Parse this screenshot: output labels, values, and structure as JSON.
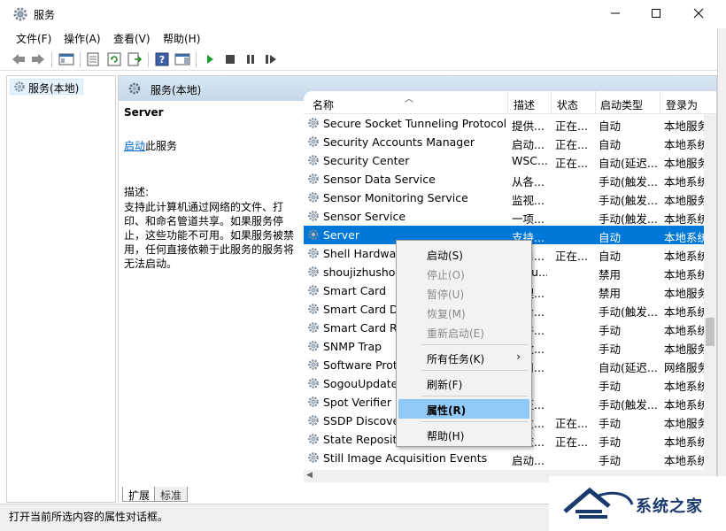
{
  "window": {
    "title": "服务"
  },
  "menu": [
    "文件(F)",
    "操作(A)",
    "查看(V)",
    "帮助(H)"
  ],
  "tree": {
    "root": "服务(本地)"
  },
  "panel": {
    "header": "服务(本地)",
    "selected_service": "Server",
    "start_link": "启动",
    "start_suffix": "此服务",
    "desc_label": "描述:",
    "desc_text": "支持此计算机通过网络的文件、打印、和命名管道共享。如果服务停止，这些功能不可用。如果服务被禁用，任何直接依赖于此服务的服务将无法启动。"
  },
  "columns": [
    "名称",
    "描述",
    "状态",
    "启动类型",
    "登录为"
  ],
  "rows": [
    {
      "name": "Secure Socket Tunneling Protocol...",
      "desc": "提供...",
      "state": "正在...",
      "start": "自动",
      "logon": "本地服务"
    },
    {
      "name": "Security Accounts Manager",
      "desc": "启动...",
      "state": "正在...",
      "start": "自动",
      "logon": "本地系统"
    },
    {
      "name": "Security Center",
      "desc": "WSC...",
      "state": "正在...",
      "start": "自动(延迟...",
      "logon": "本地服务"
    },
    {
      "name": "Sensor Data Service",
      "desc": "从各...",
      "state": "",
      "start": "手动(触发...",
      "logon": "本地系统"
    },
    {
      "name": "Sensor Monitoring Service",
      "desc": "监视...",
      "state": "",
      "start": "手动(触发...",
      "logon": "本地服务"
    },
    {
      "name": "Sensor Service",
      "desc": "一项...",
      "state": "",
      "start": "手动(触发...",
      "logon": "本地系统"
    },
    {
      "name": "Server",
      "desc": "支持...",
      "state": "",
      "start": "自动",
      "logon": "本地系统"
    },
    {
      "name": "Shell Hardware Detection",
      "desc": "为自...",
      "state": "正在...",
      "start": "自动",
      "logon": "本地系统"
    },
    {
      "name": "shoujizhushou",
      "desc": "shou...",
      "state": "",
      "start": "禁用",
      "logon": "本地系统"
    },
    {
      "name": "Smart Card",
      "desc": "管理...",
      "state": "",
      "start": "禁用",
      "logon": "本地服务"
    },
    {
      "name": "Smart Card Device Enumeration",
      "desc": "为给...",
      "state": "",
      "start": "手动(触发...",
      "logon": "本地系统"
    },
    {
      "name": "Smart Card Removal Policy",
      "desc": "允许...",
      "state": "",
      "start": "手动",
      "logon": "本地系统"
    },
    {
      "name": "SNMP Trap",
      "desc": "接收...",
      "state": "",
      "start": "手动",
      "logon": "本地服务"
    },
    {
      "name": "Software Protection",
      "desc": "启用...",
      "state": "",
      "start": "自动(延迟...",
      "logon": "网络服务"
    },
    {
      "name": "SogouUpdate",
      "desc": "",
      "state": "",
      "start": "手动",
      "logon": "本地系统"
    },
    {
      "name": "Spot Verifier",
      "desc": "验证...",
      "state": "",
      "start": "手动(触发...",
      "logon": "本地系统"
    },
    {
      "name": "SSDP Discovery",
      "desc": "当发...",
      "state": "正在...",
      "start": "手动",
      "logon": "本地服务"
    },
    {
      "name": "State Repository Service",
      "desc": "为应...",
      "state": "正在...",
      "start": "手动",
      "logon": "本地系统"
    },
    {
      "name": "Still Image Acquisition Events",
      "desc": "启动...",
      "state": "",
      "start": "手动",
      "logon": "本地系统"
    }
  ],
  "context_menu": {
    "start": "启动(S)",
    "stop": "停止(O)",
    "pause": "暂停(U)",
    "resume": "恢复(M)",
    "restart": "重新启动(E)",
    "all_tasks": "所有任务(K)",
    "refresh": "刷新(F)",
    "properties": "属性(R)",
    "help": "帮助(H)"
  },
  "tabs": [
    "扩展",
    "标准"
  ],
  "status": "打开当前所选内容的属性对话框。",
  "watermark": "系统之家",
  "colors": {
    "selection": "#0078d7",
    "menu_highlight": "#91c9f7",
    "link": "#0066cc",
    "header_gradient": "#c6d8ea"
  }
}
